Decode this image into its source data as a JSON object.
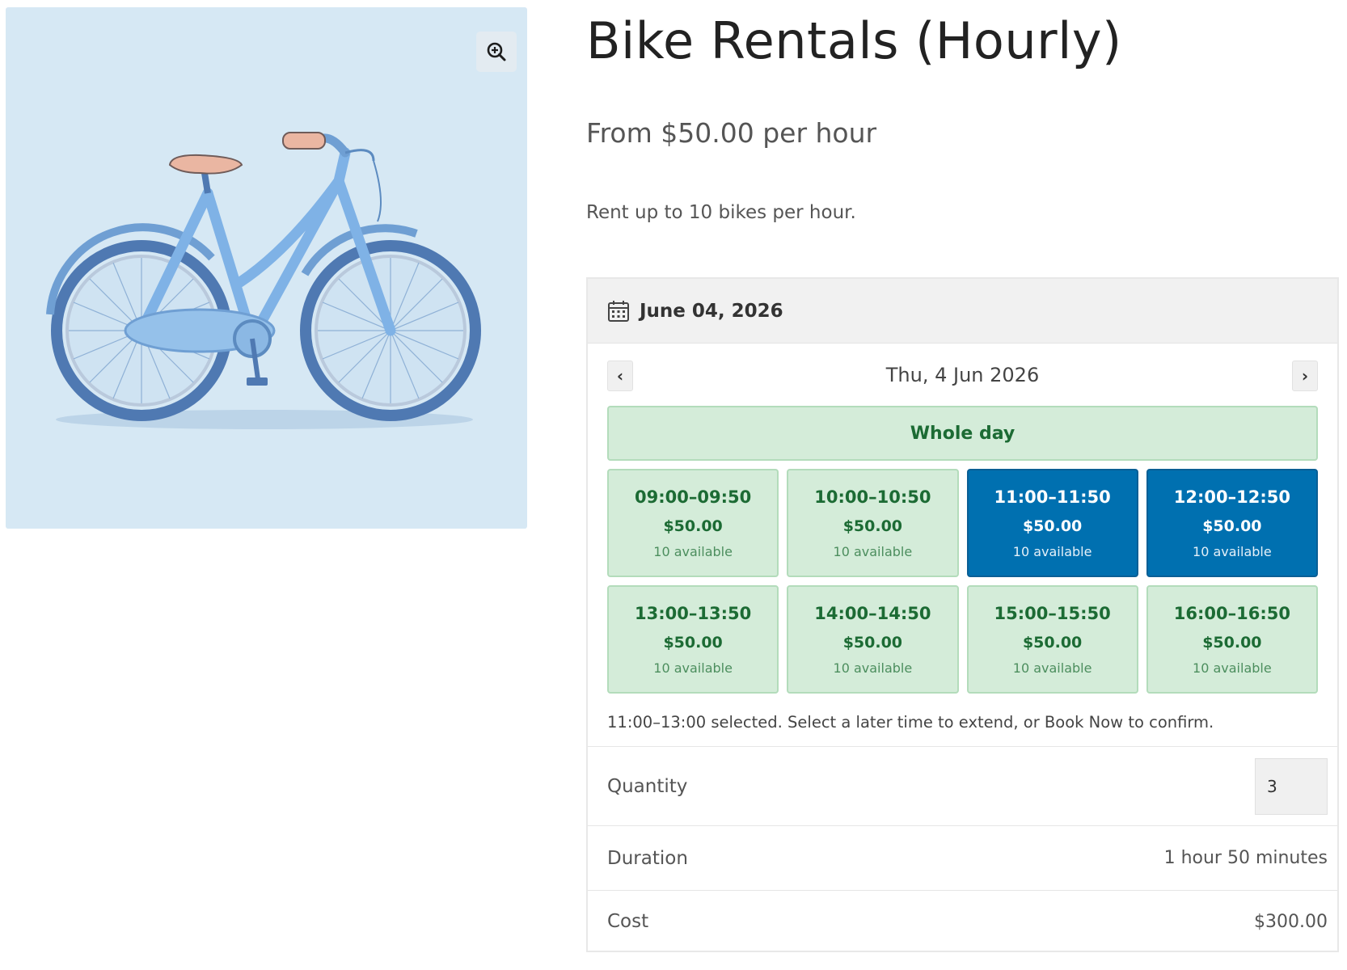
{
  "product": {
    "title": "Bike Rentals (Hourly)",
    "price": "From $50.00 per hour",
    "short_description": "Rent up to 10 bikes per hour.",
    "image_icon": "bicycle-illustration",
    "zoom_icon": "zoom-in-icon"
  },
  "booking": {
    "selected_date": "June 04, 2026",
    "calendar_icon": "calendar-icon",
    "current_day": "Thu, 4 Jun 2026",
    "prev_label": "‹",
    "next_label": "›",
    "whole_day_label": "Whole day",
    "slots": [
      {
        "time": "09:00–09:50",
        "price": "$50.00",
        "availability": "10 available",
        "selected": false
      },
      {
        "time": "10:00–10:50",
        "price": "$50.00",
        "availability": "10 available",
        "selected": false
      },
      {
        "time": "11:00–11:50",
        "price": "$50.00",
        "availability": "10 available",
        "selected": true
      },
      {
        "time": "12:00–12:50",
        "price": "$50.00",
        "availability": "10 available",
        "selected": true
      },
      {
        "time": "13:00–13:50",
        "price": "$50.00",
        "availability": "10 available",
        "selected": false
      },
      {
        "time": "14:00–14:50",
        "price": "$50.00",
        "availability": "10 available",
        "selected": false
      },
      {
        "time": "15:00–15:50",
        "price": "$50.00",
        "availability": "10 available",
        "selected": false
      },
      {
        "time": "16:00–16:50",
        "price": "$50.00",
        "availability": "10 available",
        "selected": false
      }
    ],
    "selection_note": "11:00–13:00 selected. Select a later time to extend, or Book Now to confirm.",
    "quantity_label": "Quantity",
    "quantity_value": "3",
    "duration_label": "Duration",
    "duration_value": "1 hour 50 minutes",
    "cost_label": "Cost",
    "cost_value": "$300.00"
  },
  "colors": {
    "slot_available_bg": "#d4ecd9",
    "slot_available_text": "#1c6b34",
    "slot_selected_bg": "#0070b0",
    "image_bg": "#d6e8f4"
  }
}
